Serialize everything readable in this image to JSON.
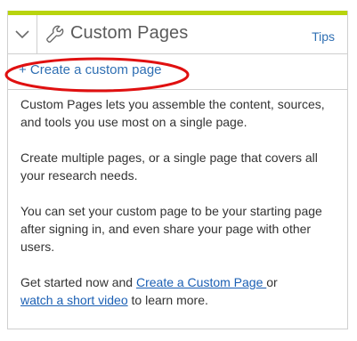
{
  "panel": {
    "title": "Custom Pages",
    "tips_label": "Tips",
    "collapse_icon": "chevron-down-icon",
    "title_icon": "wrench-icon",
    "accent_color": "#b8d40e"
  },
  "create_link": {
    "label": "+ Create a custom page"
  },
  "annotation": {
    "color": "#e01010"
  },
  "body": {
    "paragraph1": "Custom Pages lets you assemble the content, sources, and tools you use most on a single page.",
    "paragraph2": "Create multiple pages, or a single page that covers all your research needs.",
    "paragraph3": "You can set your custom page to be your starting page after signing in, and even share your page with other users.",
    "p4_prefix": "Get started now and ",
    "p4_link1": "Create a Custom Page ",
    "p4_middle": "or",
    "p4_link2": "watch a short video",
    "p4_suffix": " to learn more."
  }
}
